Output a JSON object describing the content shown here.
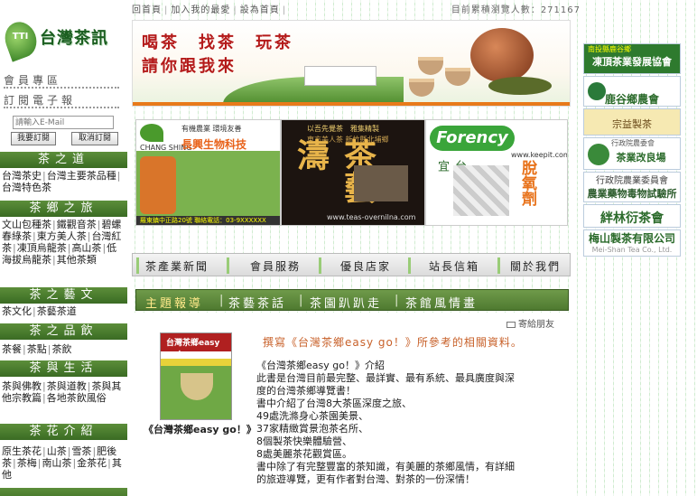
{
  "topbar": {
    "links": [
      "回首頁",
      "加入我的最愛",
      "設為首頁"
    ],
    "visitor_label": "目前累積瀏覽人數：",
    "visitor_count": "271167"
  },
  "logo": {
    "badge": "TTI",
    "text": "台灣茶訊"
  },
  "member": {
    "zone": "會員專區",
    "subscribe_title": "訂閱電子報",
    "email_placeholder": "請輸入E-Mail",
    "subscribe_button": "我要訂閱",
    "unsubscribe_button": "取消訂閱"
  },
  "sidebar": {
    "sections": [
      {
        "title": "茶之道",
        "lines": [
          [
            "台灣茶史",
            "台灣主要茶品種",
            "台灣特色茶"
          ]
        ]
      },
      {
        "title": "茶鄉之旅",
        "lines": [
          [
            "文山包種茶",
            "鐵觀音茶",
            "碧螺春綠茶",
            "東方美人茶",
            "台灣紅茶",
            "凍頂烏龍茶",
            "高山茶",
            "低海拔烏龍茶",
            "其他茶類"
          ]
        ]
      },
      {
        "title": "茶之藝文",
        "lines": [
          [
            "茶文化",
            "茶藝茶道"
          ]
        ]
      },
      {
        "title": "茶之品飲",
        "lines": [
          [
            "茶餐",
            "茶點",
            "茶飲"
          ]
        ]
      },
      {
        "title": "茶與生活",
        "lines": [
          [
            "茶與佛教",
            "茶與道教",
            "茶與其他宗教篇",
            "各地茶飲風俗"
          ]
        ]
      },
      {
        "title": "茶花介紹",
        "lines": [
          [
            "原生茶花",
            "山茶",
            "雪茶",
            "肥後茶",
            "茶梅",
            "南山茶",
            "金茶花",
            "其他"
          ]
        ]
      }
    ]
  },
  "banner": {
    "line1": "喝茶　找茶　玩茶",
    "line2": "請你跟我來"
  },
  "ads": {
    "ad1": {
      "small": "有機農業  環境友善",
      "company": "長興生物科技",
      "bottom": "羅東鎮中正路20號 聯絡電話：03-9XXXXXX",
      "brand": "CHANG SHING"
    },
    "ad2": {
      "big": "茶藝濤",
      "top": "以吾先覺茶　雅集精製",
      "top2": "東方美人茶 新竹縣北埔鄉",
      "url": "www.teas-overnilna.com"
    },
    "ad3": {
      "brand": "Forency",
      "url": "www.keepit.com.tw",
      "v1": "台灣多道宜",
      "v2": "脫氧劑"
    }
  },
  "right_ads": {
    "r1_a": "南投縣鹿谷鄉",
    "r1_b": "凍頂茶業發展協會",
    "r2": "鹿谷鄉農會",
    "r3": "宗益製茶",
    "r4_top": "行政院農委會",
    "r4_b": "茶業改良場",
    "r5_a": "行政院農業委員會",
    "r5_b": "農業藥物毒物試驗所",
    "r6": "絆林衍茶會",
    "r7_a": "梅山製茶有限公司",
    "r7_b": "Mei-Shan Tea Co., Ltd."
  },
  "main_nav": [
    "茶產業新聞",
    "會員服務",
    "優良店家",
    "站長信箱",
    "關於我們"
  ],
  "tabs": [
    "主題報導",
    "茶藝茶話",
    "茶園趴趴走",
    "茶館風情畫"
  ],
  "content": {
    "send_friend": "寄給朋友",
    "headline": "撰寫《台灣茶鄉easy go！》所參考的相關資料。",
    "book_title": "台灣茶鄉easy go！",
    "book_caption": "《台灣茶鄉easy go！》",
    "description": [
      "《台灣茶鄉easy go！》介紹",
      "此書是台灣目前最完整、最詳實、最有系統、最具廣度與深",
      "度的台灣茶鄉導覽書！",
      "書中介紹了台灣8大茶區深度之旅、",
      "49處洗滌身心茶園美景、",
      "37家精緻賞景泡茶名所、",
      "8個製茶快樂體驗營、",
      "8處美麗茶花觀賞區。",
      "書中除了有完整豐富的茶知識，有美麗的茶鄉風情，有詳細",
      "的旅遊導覽，更有作者對台灣、對茶的一份深情！"
    ]
  }
}
